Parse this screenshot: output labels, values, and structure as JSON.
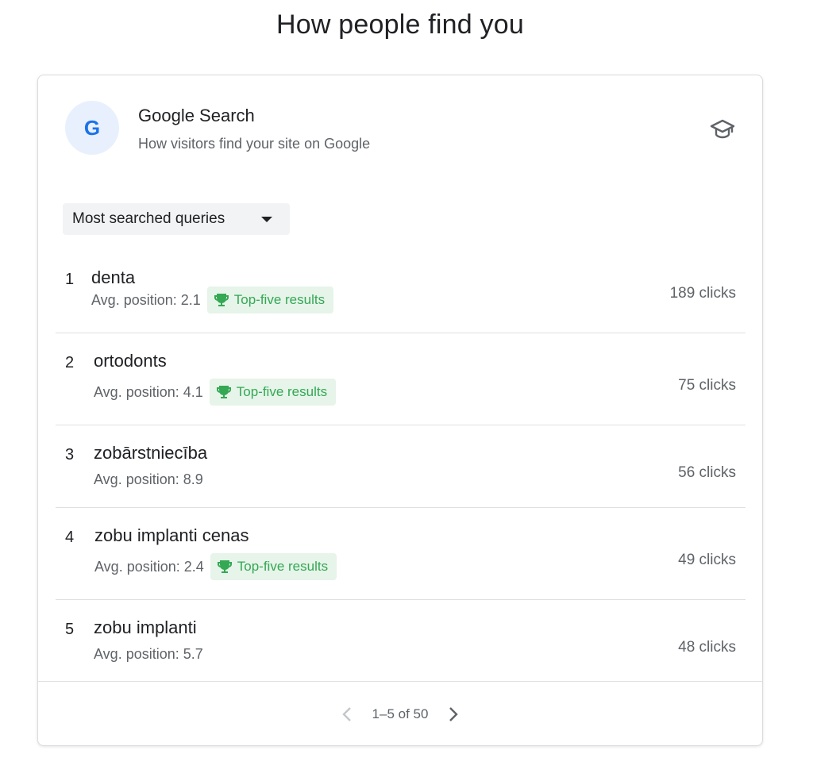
{
  "page": {
    "title": "How people find you"
  },
  "card": {
    "avatar_letter": "G",
    "title": "Google Search",
    "subtitle": "How visitors find your site on Google",
    "learn_icon": "school-icon"
  },
  "dropdown": {
    "label": "Most searched queries"
  },
  "queries": [
    {
      "rank": "1",
      "name": "denta",
      "avg": "Avg. position: 2.1",
      "badge": "Top-five results",
      "clicks": "189 clicks"
    },
    {
      "rank": "2",
      "name": "ortodonts",
      "avg": "Avg. position: 4.1",
      "badge": "Top-five results",
      "clicks": "75 clicks"
    },
    {
      "rank": "3",
      "name": "zobārstniecība",
      "avg": "Avg. position: 8.9",
      "badge": "",
      "clicks": "56 clicks"
    },
    {
      "rank": "4",
      "name": "zobu implanti cenas",
      "avg": "Avg. position: 2.4",
      "badge": "Top-five results",
      "clicks": "49 clicks"
    },
    {
      "rank": "5",
      "name": "zobu implanti",
      "avg": "Avg. position: 5.7",
      "badge": "",
      "clicks": "48 clicks"
    }
  ],
  "pagination": {
    "label": "1–5 of 50"
  },
  "colors": {
    "accent": "#1a73e8",
    "success": "#34a853",
    "success_bg": "#e6f4ea",
    "muted": "#5f6368"
  }
}
